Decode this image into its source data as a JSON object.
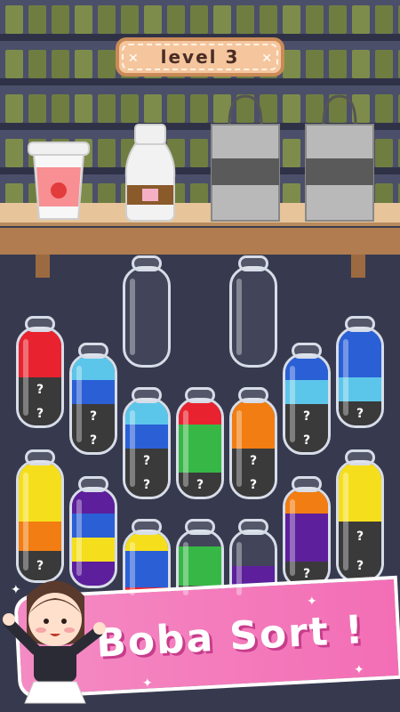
{
  "level_badge": {
    "label": "level 3"
  },
  "banner": {
    "title": "Boba Sort !"
  },
  "unknown_mark": "?",
  "colors": {
    "red": "#e8232f",
    "blue": "#2a5fd6",
    "light_blue": "#5cc6ea",
    "yellow": "#f5df1d",
    "orange": "#f27d12",
    "green": "#37b846",
    "purple": "#5d1f9b",
    "hidden": "#3a3a3a",
    "pink_banner": "#f36eb5",
    "badge": "#f5c69e"
  },
  "bottles": [
    {
      "id": 1,
      "layers": [
        "hidden",
        "hidden",
        "red",
        "red"
      ]
    },
    {
      "id": 2,
      "layers": []
    },
    {
      "id": 3,
      "layers": []
    },
    {
      "id": 4,
      "layers": [
        "hidden",
        "hidden",
        "blue",
        "light_blue"
      ]
    },
    {
      "id": 5,
      "layers": [
        "hidden",
        "hidden",
        "blue",
        "light_blue"
      ]
    },
    {
      "id": 6,
      "layers": [
        "hidden",
        "hidden",
        "light_blue",
        "blue"
      ]
    },
    {
      "id": 7,
      "layers": [
        "hidden",
        "light_blue",
        "blue",
        "blue"
      ]
    },
    {
      "id": 8,
      "layers": [
        "hidden",
        "green",
        "green",
        "red"
      ]
    },
    {
      "id": 9,
      "layers": [
        "hidden",
        "hidden",
        "orange",
        "orange"
      ]
    },
    {
      "id": 10,
      "layers": [
        "hidden",
        "orange",
        "yellow",
        "yellow"
      ]
    },
    {
      "id": 11,
      "layers": [
        "purple",
        "yellow",
        "blue",
        "purple"
      ]
    },
    {
      "id": 12,
      "layers": [
        "hidden",
        "purple",
        "purple",
        "orange"
      ]
    },
    {
      "id": 13,
      "layers": [
        "hidden",
        "hidden",
        "yellow",
        "yellow"
      ]
    },
    {
      "id": 14,
      "layers": [
        "red",
        "blue",
        "blue",
        "yellow"
      ]
    },
    {
      "id": 15,
      "layers": [
        "hidden",
        "green",
        "green"
      ]
    },
    {
      "id": 16,
      "layers": [
        "hidden",
        "purple"
      ]
    },
    {
      "id": 17,
      "layers": [
        "hidden",
        "light_blue",
        "light_blue"
      ]
    }
  ]
}
